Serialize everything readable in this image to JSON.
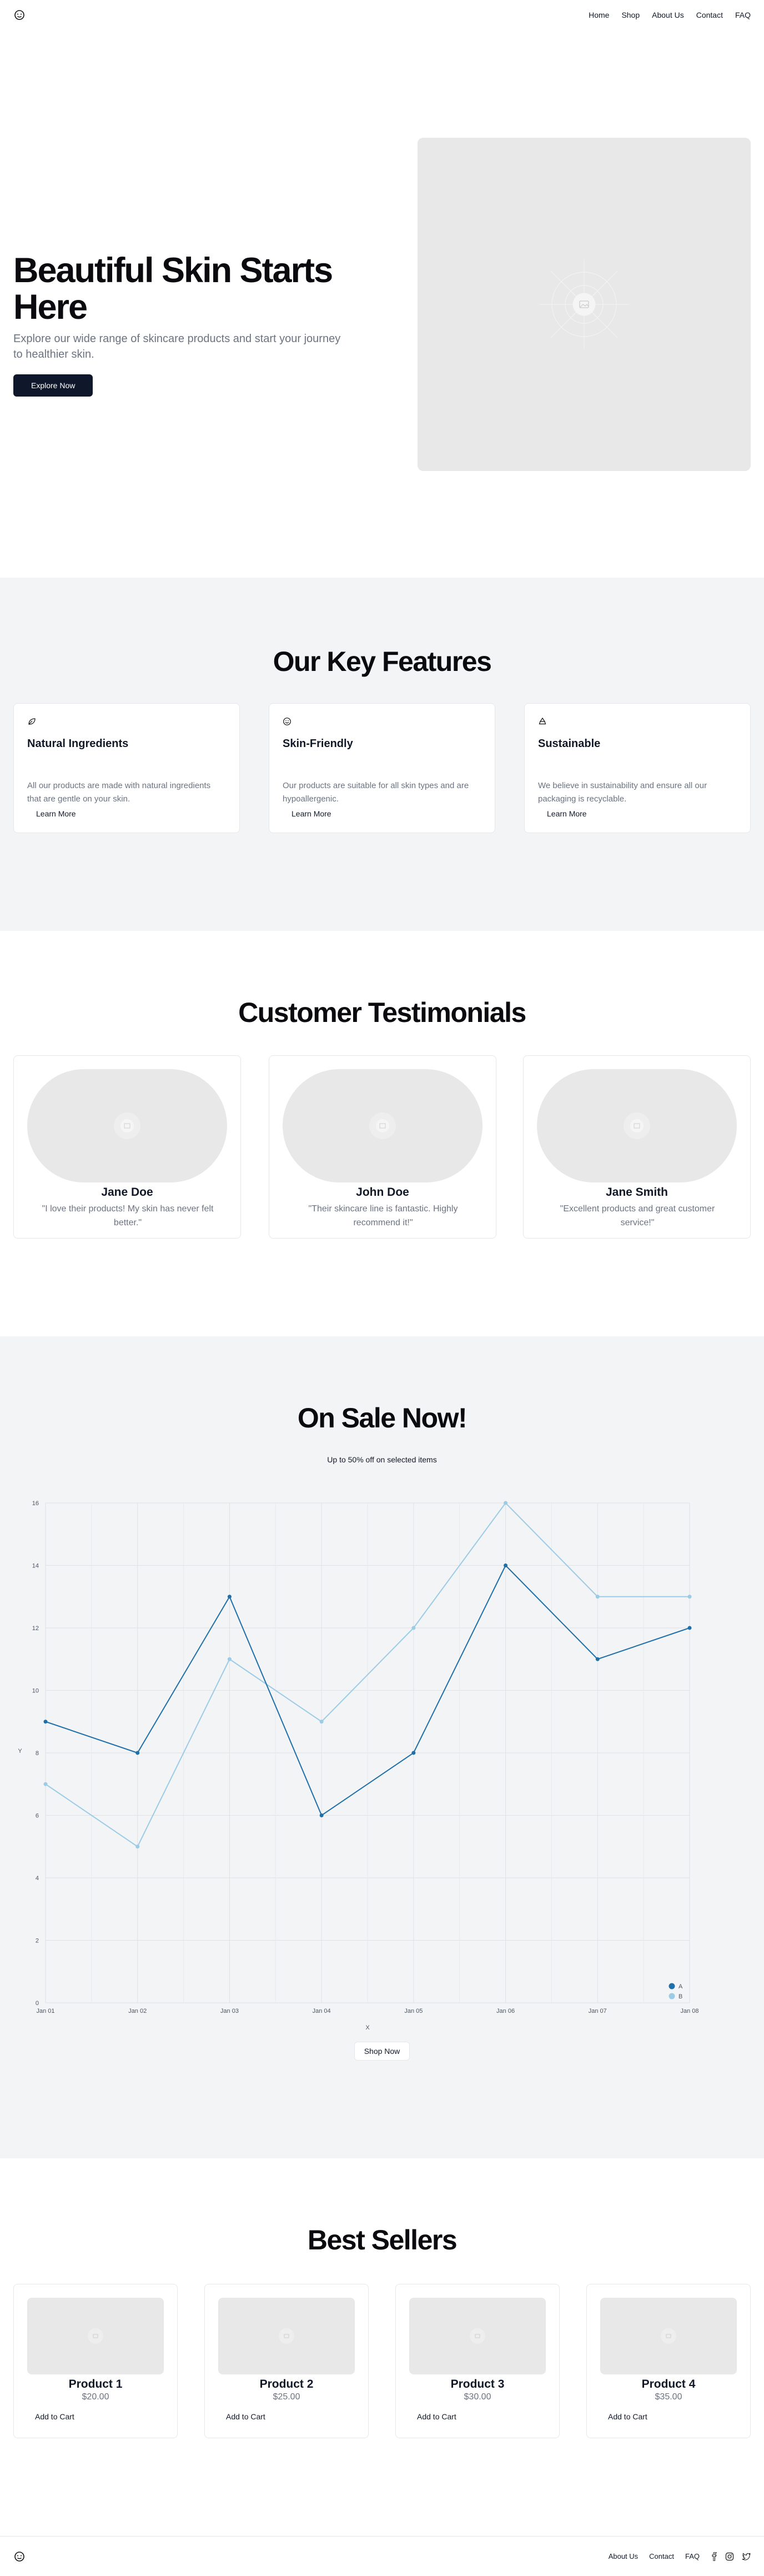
{
  "nav": {
    "links": [
      "Home",
      "Shop",
      "About Us",
      "Contact",
      "FAQ"
    ]
  },
  "hero": {
    "title": "Beautiful Skin Starts Here",
    "subtitle": "Explore our wide range of skincare products and start your journey to healthier skin.",
    "cta": "Explore Now"
  },
  "features": {
    "title": "Our Key Features",
    "items": [
      {
        "icon": "leaf-icon",
        "title": "Natural Ingredients",
        "text": "All our products are made with natural ingredients that are gentle on your skin.",
        "link": "Learn More"
      },
      {
        "icon": "smile-icon",
        "title": "Skin-Friendly",
        "text": "Our products are suitable for all skin types and are hypoallergenic.",
        "link": "Learn More"
      },
      {
        "icon": "recycle-icon",
        "title": "Sustainable",
        "text": "We believe in sustainability and ensure all our packaging is recyclable.",
        "link": "Learn More"
      }
    ]
  },
  "testimonials": {
    "title": "Customer Testimonials",
    "items": [
      {
        "name": "Jane Doe",
        "quote": "\"I love their products! My skin has never felt better.\""
      },
      {
        "name": "John Doe",
        "quote": "\"Their skincare line is fantastic. Highly recommend it!\""
      },
      {
        "name": "Jane Smith",
        "quote": "\"Excellent products and great customer service!\""
      }
    ]
  },
  "sale": {
    "title": "On Sale Now!",
    "subtitle": "Up to 50% off on selected items",
    "cta": "Shop Now"
  },
  "chart_data": {
    "type": "line",
    "categories": [
      "Jan 01",
      "Jan 02",
      "Jan 03",
      "Jan 04",
      "Jan 05",
      "Jan 06",
      "Jan 07",
      "Jan 08"
    ],
    "series": [
      {
        "name": "A",
        "values": [
          9,
          8,
          13,
          6,
          8,
          14,
          11,
          12
        ],
        "color": "#1f6fa8"
      },
      {
        "name": "B",
        "values": [
          7,
          5,
          11,
          9,
          12,
          16,
          13,
          13
        ],
        "color": "#9ccbe5"
      }
    ],
    "xlabel": "X",
    "ylabel": "Y",
    "ylim": [
      0,
      16
    ],
    "yticks": [
      0,
      2,
      4,
      6,
      8,
      10,
      12,
      14,
      16
    ],
    "grid": true,
    "legend": "bottom-right"
  },
  "best_sellers": {
    "title": "Best Sellers",
    "items": [
      {
        "name": "Product 1",
        "price": "$20.00",
        "cta": "Add to Cart"
      },
      {
        "name": "Product 2",
        "price": "$25.00",
        "cta": "Add to Cart"
      },
      {
        "name": "Product 3",
        "price": "$30.00",
        "cta": "Add to Cart"
      },
      {
        "name": "Product 4",
        "price": "$35.00",
        "cta": "Add to Cart"
      }
    ]
  },
  "footer": {
    "links": [
      "About Us",
      "Contact",
      "FAQ"
    ],
    "social": [
      "facebook-icon",
      "instagram-icon",
      "twitter-icon"
    ]
  }
}
